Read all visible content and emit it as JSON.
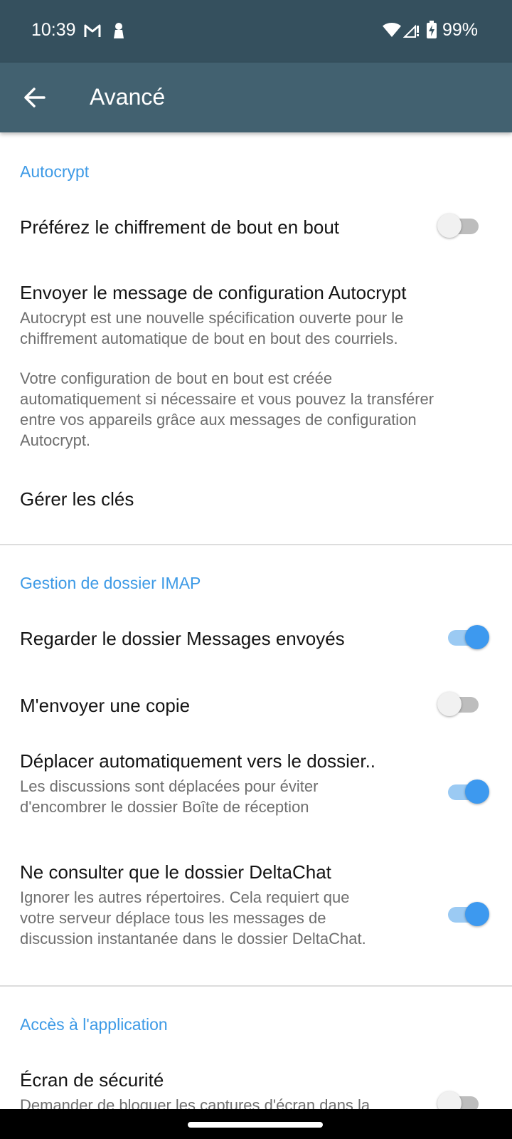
{
  "status_bar": {
    "time": "10:39",
    "battery": "99%"
  },
  "app_bar": {
    "title": "Avancé",
    "back_icon": "arrow-left-icon"
  },
  "sections": {
    "autocrypt": {
      "header": "Autocrypt",
      "prefer_e2e": {
        "title": "Préférez le chiffrement de bout en bout",
        "enabled": false
      },
      "send_setup": {
        "title": "Envoyer le message de configuration Autocrypt",
        "summary_line1": "Autocrypt est une nouvelle spécification ouverte pour le",
        "summary_line2": "chiffrement automatique de bout en bout des courriels.",
        "summary_line3": "Votre configuration de bout en bout est créée",
        "summary_line4": "automatiquement si nécessaire et vous pouvez la transférer",
        "summary_line5": "entre vos appareils grâce aux messages de configuration",
        "summary_line6": "Autocrypt."
      },
      "manage_keys": {
        "title": "Gérer les clés"
      }
    },
    "imap": {
      "header": "Gestion de dossier IMAP",
      "watch_sent": {
        "title": "Regarder le dossier Messages envoyés",
        "enabled": true
      },
      "send_copy": {
        "title": "M'envoyer une copie",
        "enabled": false
      },
      "auto_move": {
        "title": "Déplacer automatiquement vers le dossier..",
        "summary_line1": "Les discussions sont déplacées pour éviter",
        "summary_line2": "d'encombrer le dossier Boîte de réception",
        "enabled": true
      },
      "only_deltachat": {
        "title": "Ne consulter que le dossier DeltaChat",
        "summary_line1": "Ignorer les autres répertoires. Cela requiert que",
        "summary_line2": "votre serveur déplace tous les messages de",
        "summary_line3": "discussion instantanée dans le dossier DeltaChat.",
        "enabled": true
      }
    },
    "app_access": {
      "header": "Accès à l'application",
      "screen_security": {
        "title": "Écran de sécurité",
        "summary_line1": "Demander de bloquer les captures d'écran dans la",
        "enabled": false
      }
    }
  },
  "colors": {
    "status_bar": "#35505e",
    "app_bar": "#426170",
    "accent": "#3d99ef",
    "section_header": "#3d9ae6"
  }
}
